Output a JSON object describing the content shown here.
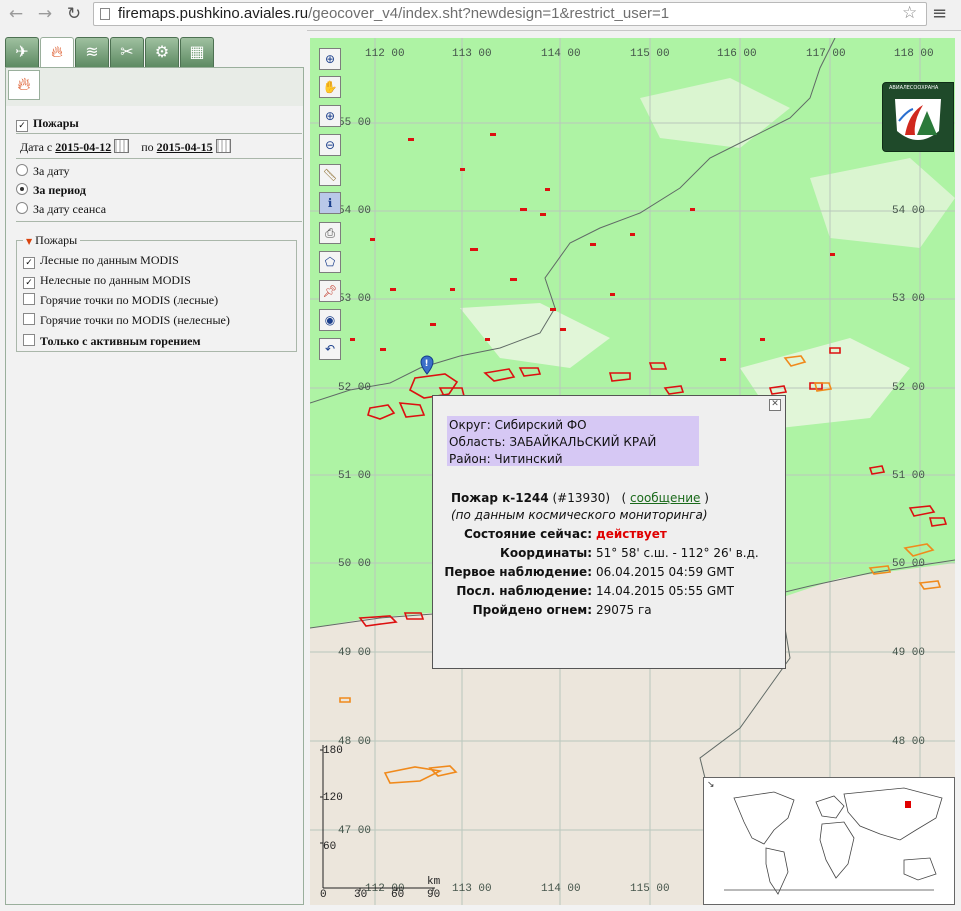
{
  "browser": {
    "url_host": "firemaps.pushkino.aviales.ru",
    "url_path": "/geocover_v4/index.sht?newdesign=1&restrict_user=1"
  },
  "panel": {
    "fires_label": "Пожары",
    "date_from_label": "Дата с",
    "date_from": "2015-04-12",
    "date_to_label": "по",
    "date_to": "2015-04-15",
    "radio_options": [
      "За дату",
      "За период",
      "За дату сеанса"
    ],
    "legend": "Пожары",
    "layers": [
      {
        "label": "Лесные по данным MODIS",
        "checked": true
      },
      {
        "label": "Нелесные по данным MODIS",
        "checked": true
      },
      {
        "label": "Горячие точки по MODIS (лесные)",
        "checked": false
      },
      {
        "label": "Горячие точки по MODIS (нелесные)",
        "checked": false
      },
      {
        "label": "Только с активным горением",
        "checked": false
      }
    ]
  },
  "map": {
    "lon_labels": [
      "112 00",
      "113 00",
      "114 00",
      "115 00",
      "116 00",
      "117 00",
      "118 00"
    ],
    "lat_labels": [
      "55 00",
      "54 00",
      "53 00",
      "52 00",
      "51 00",
      "50 00",
      "49 00",
      "48 00",
      "47 00"
    ],
    "lat_labels_right": [
      "54 00",
      "53 00",
      "52 00",
      "51 00",
      "50 00",
      "49 00",
      "48 00"
    ],
    "scale_labels_y": [
      "180",
      "120",
      "60"
    ],
    "scale_labels_x": [
      "0",
      "30",
      "60",
      "90"
    ],
    "scale_unit": "km",
    "logo_text": "АВИАЛЕСООХРАНА",
    "colors": {
      "forest": "#aef3a4",
      "non_forest": "#ece6dc",
      "fire_red": "#dd1010",
      "fire_orange": "#f08a1c"
    }
  },
  "popup": {
    "okrug": "Округ: Сибирский ФО",
    "oblast": "Область: ЗАБАЙКАЛЬСКИЙ КРАЙ",
    "rayon": "Район: Читинский",
    "fire_title": "Пожар к-1244",
    "fire_id": "(#13930)",
    "message_link": "сообщение",
    "source_note": "(по данным космического мониторинга)",
    "rows": [
      {
        "label": "Состояние сейчас:",
        "value": "действует"
      },
      {
        "label": "Координаты:",
        "value": "51° 58' с.ш. - 112° 26' в.д."
      },
      {
        "label": "Первое наблюдение:",
        "value": "06.04.2015 04:59 GMT"
      },
      {
        "label": "Посл. наблюдение:",
        "value": "14.04.2015 05:55 GMT"
      },
      {
        "label": "Пройдено огнем:",
        "value": "29075 га"
      }
    ]
  }
}
